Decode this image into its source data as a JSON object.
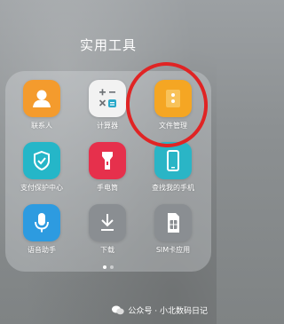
{
  "folder": {
    "title": "实用工具"
  },
  "apps": [
    {
      "label": "联系人",
      "icon": "contacts-icon",
      "color": "#f49b2d"
    },
    {
      "label": "计算器",
      "icon": "calculator-icon",
      "color": "#f2f2f2"
    },
    {
      "label": "文件管理",
      "icon": "file-manager-icon",
      "color": "#f5a623"
    },
    {
      "label": "支付保护中心",
      "icon": "payment-protection-icon",
      "color": "#25b6c8"
    },
    {
      "label": "手电筒",
      "icon": "flashlight-icon",
      "color": "#e6304c"
    },
    {
      "label": "查找我的手机",
      "icon": "find-my-phone-icon",
      "color": "#2ab5c6"
    },
    {
      "label": "语音助手",
      "icon": "voice-assistant-icon",
      "color": "#2d9be0"
    },
    {
      "label": "下载",
      "icon": "download-icon",
      "color": "#8a8e92"
    },
    {
      "label": "SIM卡应用",
      "icon": "sim-card-icon",
      "color": "#8a8e92"
    }
  ],
  "pagination": {
    "pages": 2,
    "current": 1
  },
  "watermark": {
    "text": "公众号 · 小北数码日记",
    "icon": "wechat-icon"
  },
  "highlight": {
    "color": "#e02424",
    "target": "文件管理"
  }
}
